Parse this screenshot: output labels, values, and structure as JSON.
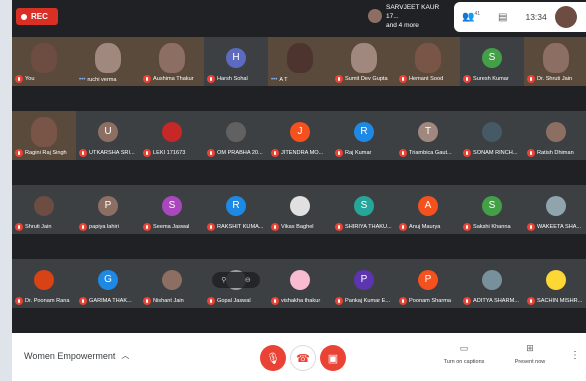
{
  "topbar": {
    "rec_label": "REC",
    "presenter_name": "SARVJEET KAUR 17...",
    "presenter_more": "and 4 more",
    "participants_count": "41",
    "clock": "13:34"
  },
  "tiles": [
    {
      "name": "You",
      "kind": "video",
      "color": "#6d4c41"
    },
    {
      "name": "ruchi verma",
      "kind": "video",
      "color": "#a1887f",
      "dots": true
    },
    {
      "name": "Aushima Thakur",
      "kind": "video",
      "color": "#8d6e63"
    },
    {
      "name": "Harsh Sohal",
      "kind": "letter",
      "letter": "H",
      "color": "#5c6bc0"
    },
    {
      "name": "A T",
      "kind": "video",
      "color": "#4e342e",
      "dots": true
    },
    {
      "name": "Sumit Dev Gupta",
      "kind": "video",
      "color": "#a1887f"
    },
    {
      "name": "Hemant Sood",
      "kind": "video",
      "color": "#795548"
    },
    {
      "name": "Suresh Kumar",
      "kind": "letter",
      "letter": "S",
      "color": "#43a047"
    },
    {
      "name": "Dr. Shruti Jain",
      "kind": "video",
      "color": "#8d6e63"
    },
    {
      "name": "Ragini Raj Singh",
      "kind": "video",
      "color": "#795548"
    },
    {
      "name": "UTKARSHA SRI...",
      "kind": "letter",
      "letter": "U",
      "color": "#8d6e63"
    },
    {
      "name": "LEKI 171673",
      "kind": "photo",
      "color": "#c62828"
    },
    {
      "name": "OM PRABHA 20...",
      "kind": "photo",
      "color": "#616161"
    },
    {
      "name": "JITENDRA MO...",
      "kind": "letter",
      "letter": "J",
      "color": "#f4511e"
    },
    {
      "name": "Raj Kumar",
      "kind": "letter",
      "letter": "R",
      "color": "#1e88e5"
    },
    {
      "name": "Triambica Gaut...",
      "kind": "letter",
      "letter": "T",
      "color": "#a1887f"
    },
    {
      "name": "SONAM RINCH...",
      "kind": "photo",
      "color": "#455a64"
    },
    {
      "name": "Ratish Dhiman",
      "kind": "photo",
      "color": "#8d6e63"
    },
    {
      "name": "Shruti Jain",
      "kind": "photo",
      "color": "#6d4c41"
    },
    {
      "name": "papiya lahiri",
      "kind": "letter",
      "letter": "P",
      "color": "#8d6e63"
    },
    {
      "name": "Seema Jaswal",
      "kind": "letter",
      "letter": "S",
      "color": "#ab47bc"
    },
    {
      "name": "RAKSHIT KUMA...",
      "kind": "letter",
      "letter": "R",
      "color": "#1e88e5"
    },
    {
      "name": "Vikas Baghel",
      "kind": "photo",
      "color": "#e0e0e0"
    },
    {
      "name": "SHIRIYA THAKU...",
      "kind": "letter",
      "letter": "S",
      "color": "#26a69a"
    },
    {
      "name": "Anuj Maurya",
      "kind": "letter",
      "letter": "A",
      "color": "#f4511e"
    },
    {
      "name": "Sakshi Khanna",
      "kind": "letter",
      "letter": "S",
      "color": "#43a047"
    },
    {
      "name": "WAKEETA SHA...",
      "kind": "photo",
      "color": "#90a4ae"
    },
    {
      "name": "Dr. Poonam Rana",
      "kind": "photo",
      "color": "#d84315"
    },
    {
      "name": "GARIMA THAK...",
      "kind": "letter",
      "letter": "G",
      "color": "#1e88e5"
    },
    {
      "name": "Nishant Jain",
      "kind": "photo",
      "color": "#8d6e63"
    },
    {
      "name": "Gopal Jaswal",
      "kind": "hover",
      "color": "#9e9e9e"
    },
    {
      "name": "vishakha thakur",
      "kind": "photo",
      "color": "#f8bbd0"
    },
    {
      "name": "Pankaj Kumar E...",
      "kind": "letter",
      "letter": "P",
      "color": "#5e35b1"
    },
    {
      "name": "Poonam Sharma",
      "kind": "letter",
      "letter": "P",
      "color": "#f4511e"
    },
    {
      "name": "ADITYA SHARM...",
      "kind": "photo",
      "color": "#78909c"
    },
    {
      "name": "SACHIN MISHR...",
      "kind": "photo",
      "color": "#fdd835"
    }
  ],
  "bottombar": {
    "meeting_title": "Women Empowerment",
    "captions_label": "Turn on captions",
    "present_label": "Present now"
  }
}
